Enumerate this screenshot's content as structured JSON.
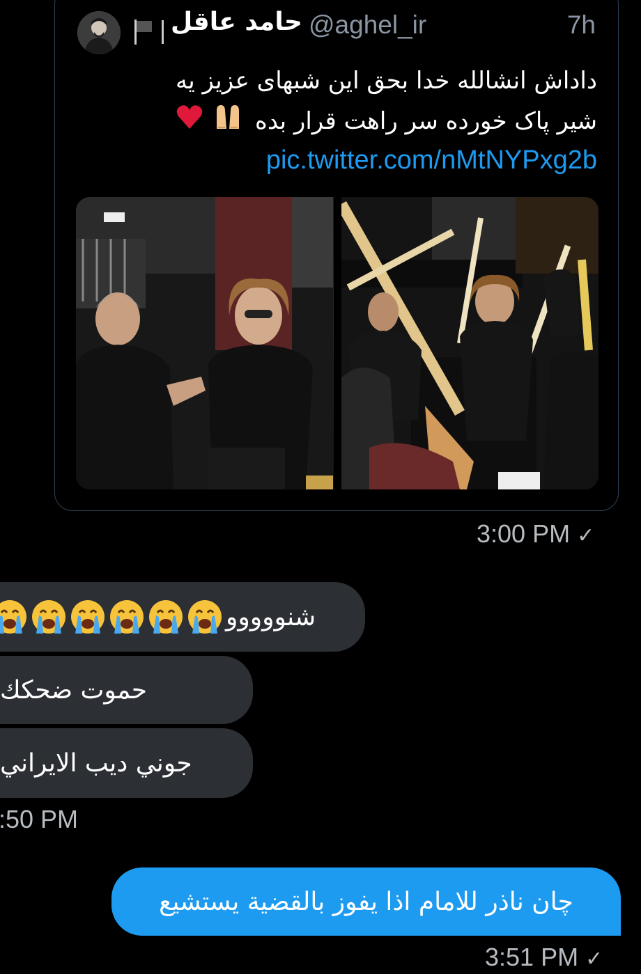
{
  "tweet": {
    "author_name": "حامد عاقل",
    "handle": "@aghel_ir",
    "time": "7h",
    "text_line1": "داداش انشالله خدا بحق این شبهای عزیز یه",
    "text_line2": "شیر پاک خورده سر راهت قرار بده",
    "text_emojis": [
      "praying-hands-icon",
      "red-heart-icon"
    ],
    "link": "pic.twitter.com/nMtNYPxg2b",
    "media": [
      "photo-left",
      "photo-right"
    ],
    "sent_time": "3:00 PM"
  },
  "messages": {
    "received_1": "شنووووو",
    "received_1_emoji_count": 6,
    "received_2": "حموت ضحكك",
    "received_3": "جوني ديب الايراني",
    "received_time": ":50 PM",
    "sent_1": "چان ناذر للامام اذا يفوز بالقضية يستشيع",
    "sent_time": "3:51 PM"
  },
  "colors": {
    "background": "#000000",
    "incoming_bubble": "#2c2f33",
    "outgoing_bubble": "#1d9bf0",
    "link": "#1d9bf0",
    "muted": "#8a96a3"
  }
}
